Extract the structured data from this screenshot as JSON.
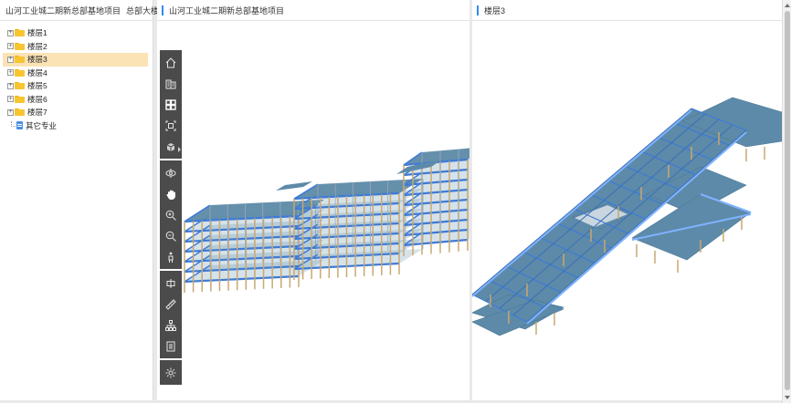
{
  "left_panel": {
    "project_name": "山河工业城二期新总部基地项目",
    "building_select": "总部大楼",
    "tree": [
      {
        "label": "楼层1",
        "selected": false
      },
      {
        "label": "楼层2",
        "selected": false
      },
      {
        "label": "楼层3",
        "selected": true
      },
      {
        "label": "楼层4",
        "selected": false
      },
      {
        "label": "楼层5",
        "selected": false
      },
      {
        "label": "楼层6",
        "selected": false
      },
      {
        "label": "楼层7",
        "selected": false
      }
    ],
    "other": "其它专业",
    "expander_symbol": "+"
  },
  "middle_view": {
    "title": "山河工业城二期新总部基地项目"
  },
  "right_view": {
    "title": "楼层3"
  },
  "toolbar": {
    "groups": [
      [
        "home-icon",
        "floors-icon",
        "grid-view-icon",
        "fit-view-icon",
        "section-box-icon"
      ],
      [
        "orbit-icon",
        "pan-hand-icon",
        "zoom-in-icon",
        "zoom-out-icon",
        "walk-icon"
      ],
      [
        "center-icon",
        "measure-ruler-icon",
        "structure-tree-icon",
        "properties-icon"
      ],
      [
        "settings-gear-icon"
      ]
    ]
  },
  "colors": {
    "accent": "#2d8cf0",
    "selected_row": "#fbe3b6",
    "toolbar_bg": "#4b4b4b",
    "slab": "#5d8aa8",
    "beam": "#3d7bd8",
    "column": "#c8a870"
  }
}
